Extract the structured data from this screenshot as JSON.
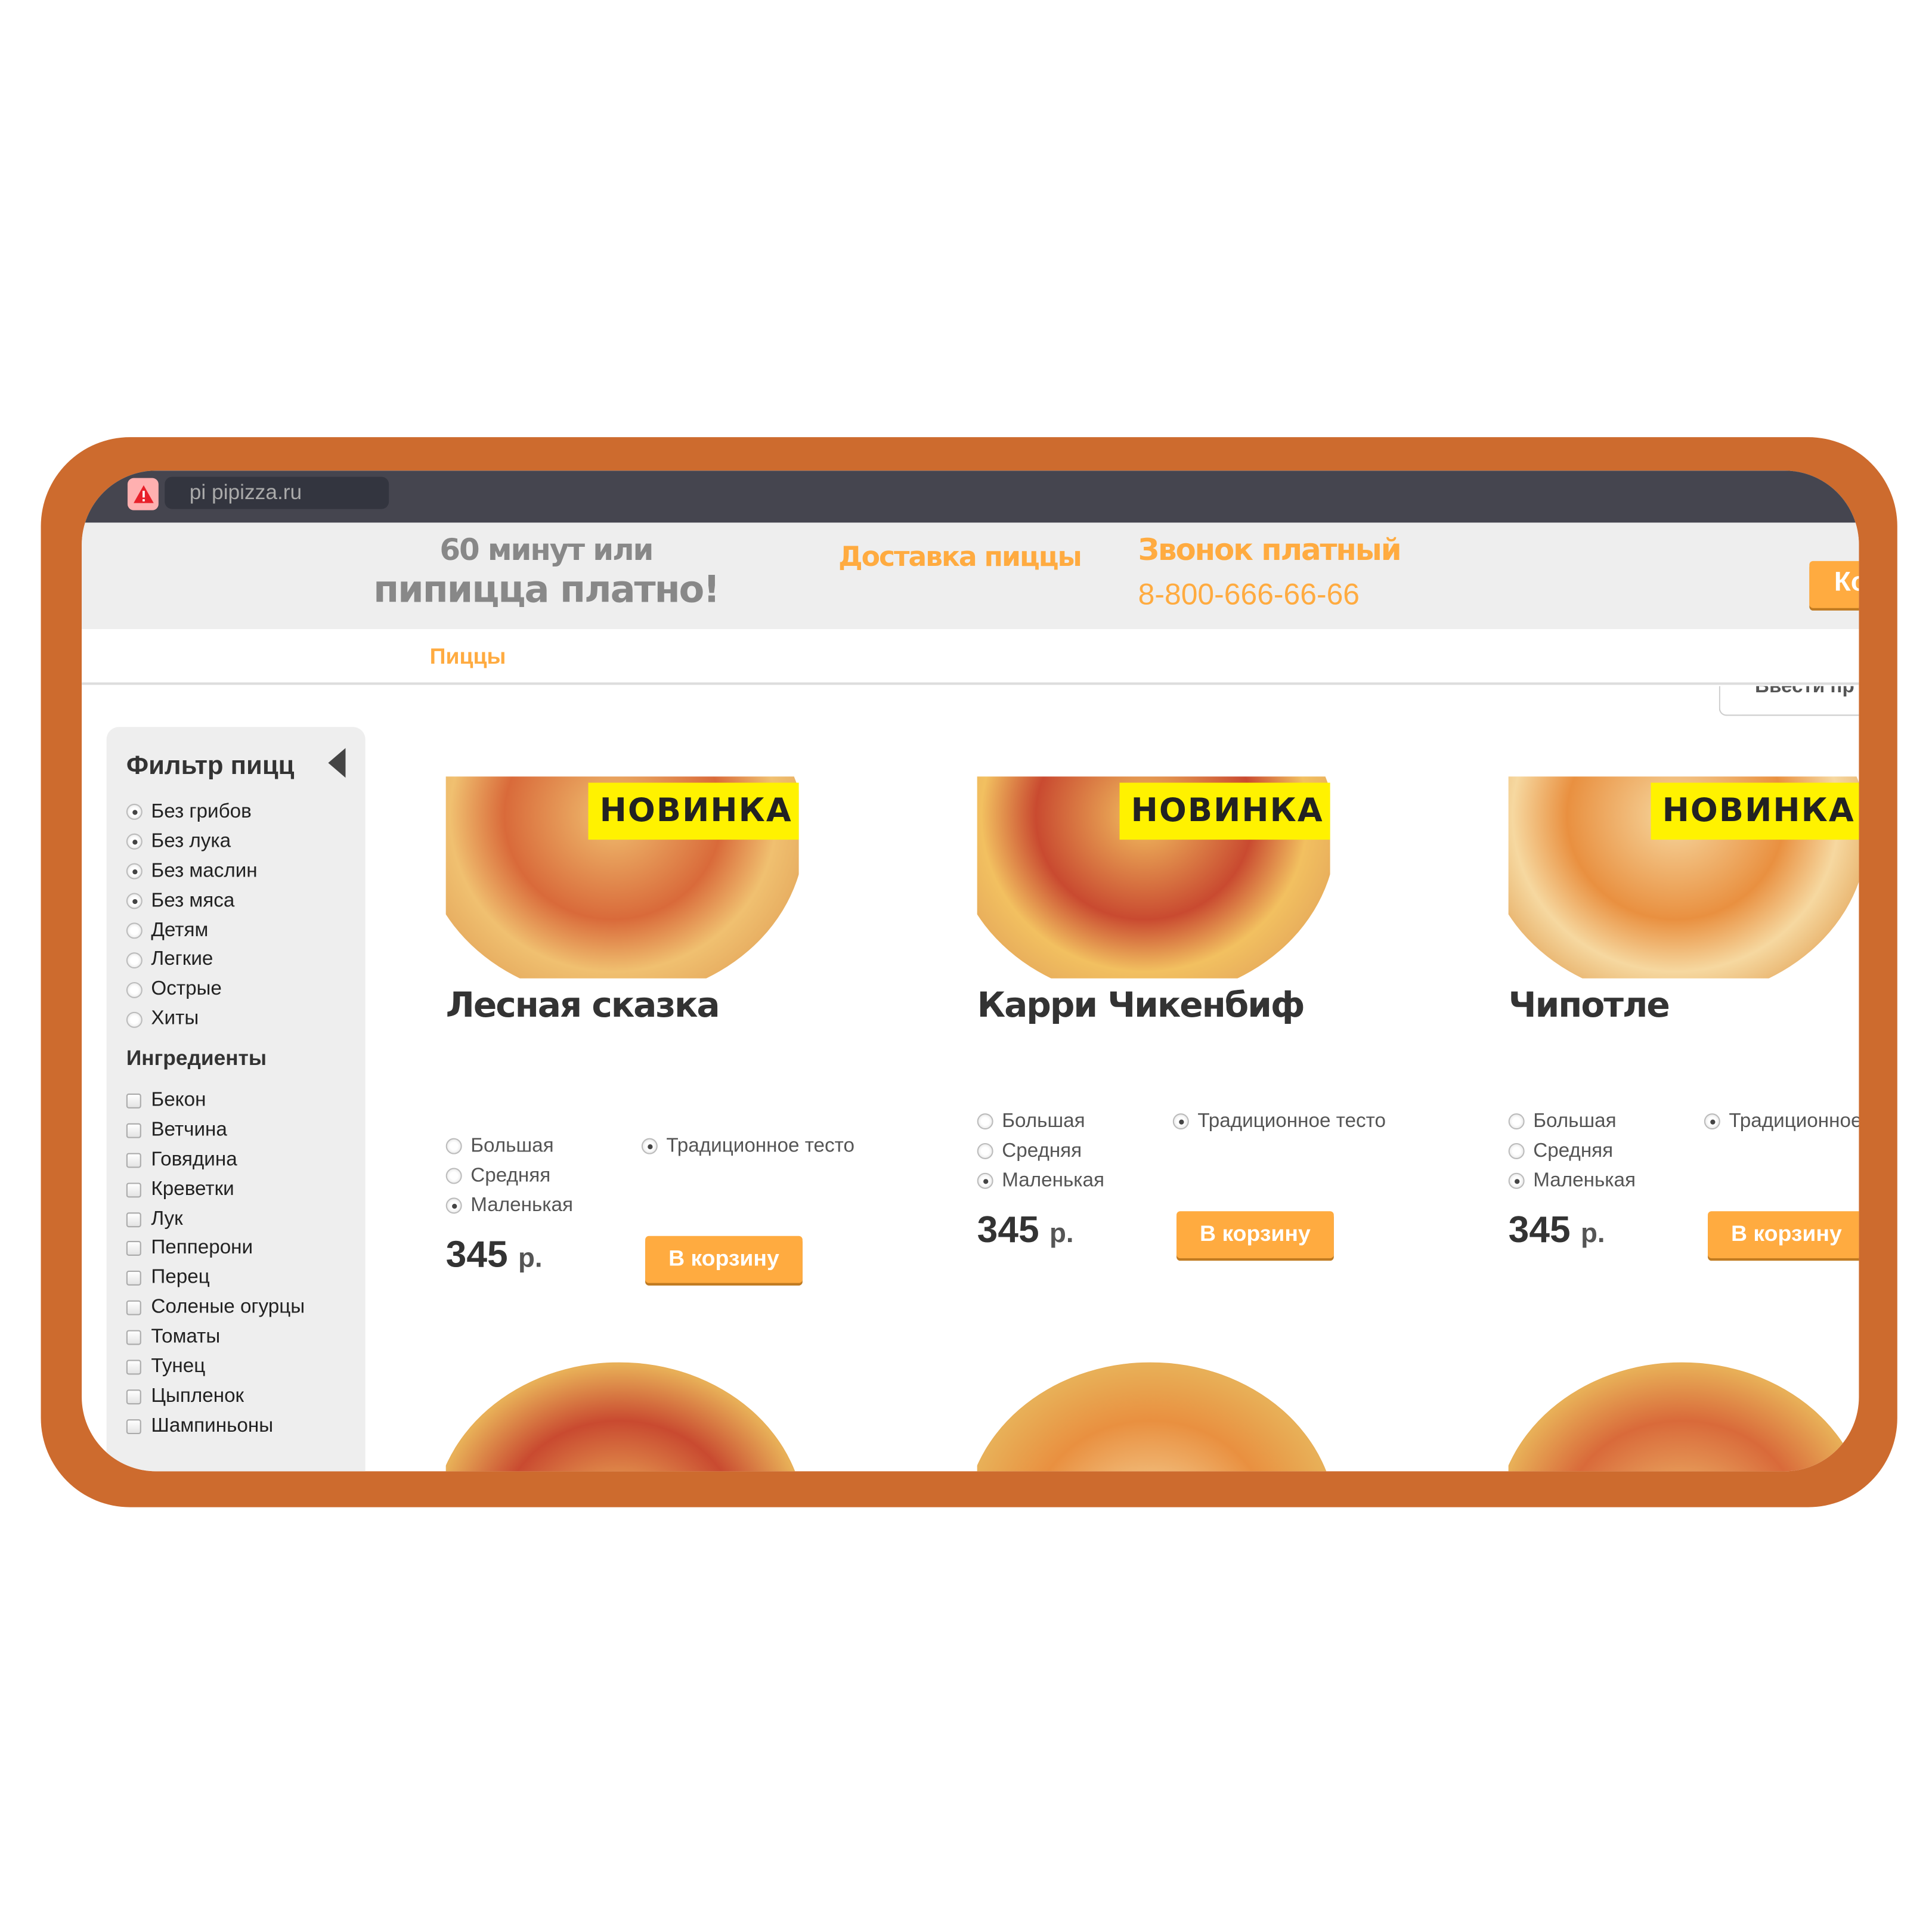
{
  "browser": {
    "address": "pi pipizza.ru"
  },
  "header": {
    "slogan_line1": "60 минут или",
    "slogan_line2": "пипицца платно!",
    "delivery_link": "Доставка пиццы",
    "call_label": "Звонок платный",
    "phone": "8-800-666-66-66",
    "cart_button": "Ко"
  },
  "nav": {
    "items": [
      "Пиццы"
    ]
  },
  "search": {
    "placeholder": "Ввести пр"
  },
  "sidebar": {
    "title": "Фильтр пицц",
    "filters": [
      {
        "label": "Без грибов",
        "checked": true
      },
      {
        "label": "Без лука",
        "checked": true
      },
      {
        "label": "Без маслин",
        "checked": true
      },
      {
        "label": "Без мяса",
        "checked": true
      },
      {
        "label": "Детям",
        "checked": false
      },
      {
        "label": "Легкие",
        "checked": false
      },
      {
        "label": "Острые",
        "checked": false
      },
      {
        "label": "Хиты",
        "checked": false
      }
    ],
    "ingredients_title": "Ингредиенты",
    "ingredients": [
      "Бекон",
      "Ветчина",
      "Говядина",
      "Креветки",
      "Лук",
      "Пепперони",
      "Перец",
      "Соленые огурцы",
      "Томаты",
      "Тунец",
      "Цыпленок",
      "Шампиньоны"
    ]
  },
  "products": [
    {
      "badge": "НОВИНКА",
      "title": "Лесная сказка",
      "sizes": [
        "Большая",
        "Средняя",
        "Маленькая"
      ],
      "selected_size": "Маленькая",
      "dough": "Традиционное тесто",
      "price": "345",
      "currency": "р.",
      "buy": "В корзину"
    },
    {
      "badge": "НОВИНКА",
      "title": "Карри Чикенбиф",
      "sizes": [
        "Большая",
        "Средняя",
        "Маленькая"
      ],
      "selected_size": "Маленькая",
      "dough": "Традиционное тесто",
      "price": "345",
      "currency": "р.",
      "buy": "В корзину"
    },
    {
      "badge": "НОВИНКА",
      "title": "Чипотле",
      "sizes": [
        "Большая",
        "Средняя",
        "Маленькая"
      ],
      "selected_size": "Маленькая",
      "dough": "Традиционное тесто",
      "price": "345",
      "currency": "р.",
      "buy": "В корзину"
    }
  ],
  "colors": {
    "frame": "#cd6b2e",
    "accent": "#ffab40",
    "badge": "#fff200",
    "topbar": "#45454f"
  }
}
